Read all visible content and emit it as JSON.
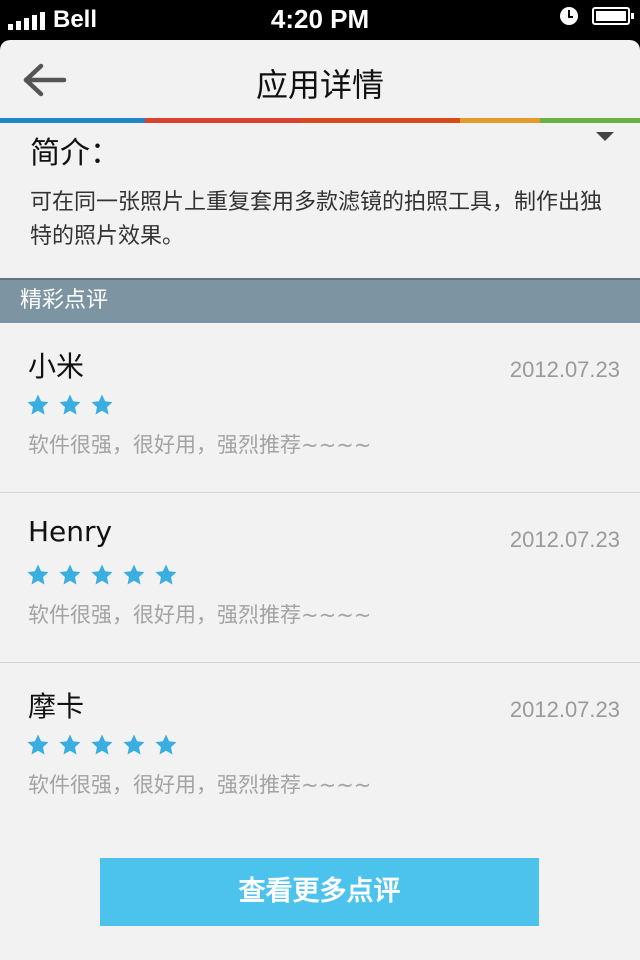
{
  "status_bar": {
    "carrier": "Bell",
    "time": "4:20 PM"
  },
  "navbar": {
    "title": "应用详情",
    "back_icon": "arrow-left-icon"
  },
  "accent_stripes": [
    "#1f86c8",
    "#d94230",
    "#d84a1b",
    "#e59a2a",
    "#6ab043"
  ],
  "intro": {
    "heading": "简介：",
    "text": "可在同一张照片上重复套用多款滤镜的拍照工具，制作出独特的照片效果。"
  },
  "reviews_section": {
    "title": "精彩点评",
    "items": [
      {
        "name": "小米",
        "date": "2012.07.23",
        "rating": 3,
        "comment": "软件很强，很好用，强烈推荐~~~~"
      },
      {
        "name": "Henry",
        "date": "2012.07.23",
        "rating": 5,
        "comment": "软件很强，很好用，强烈推荐~~~~"
      },
      {
        "name": "摩卡",
        "date": "2012.07.23",
        "rating": 5,
        "comment": "软件很强，很好用，强烈推荐~~~~"
      }
    ]
  },
  "more_button": {
    "label": "查看更多点评"
  },
  "colors": {
    "star": "#3aaee0",
    "button": "#4cc3ec",
    "section_bar": "#7d95a3"
  }
}
